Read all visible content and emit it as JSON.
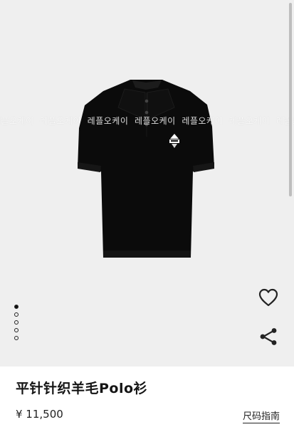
{
  "gallery": {
    "watermark": [
      "레플오케이",
      "레플오케이",
      "레플오케이",
      "레플오케이",
      "레플오케이",
      "레플오케이",
      "레플오케이"
    ],
    "slide_count": 5,
    "active_slide": 1,
    "icons": {
      "favorite": "heart-icon",
      "share": "share-icon"
    }
  },
  "product": {
    "title": "平针针织羊毛Polo衫",
    "price": "¥ 11,500",
    "size_guide_label": "尺码指南"
  },
  "colors": {
    "background": "#ffffff",
    "gallery_bg": "#efefef",
    "shirt": "#0b0b0b"
  }
}
